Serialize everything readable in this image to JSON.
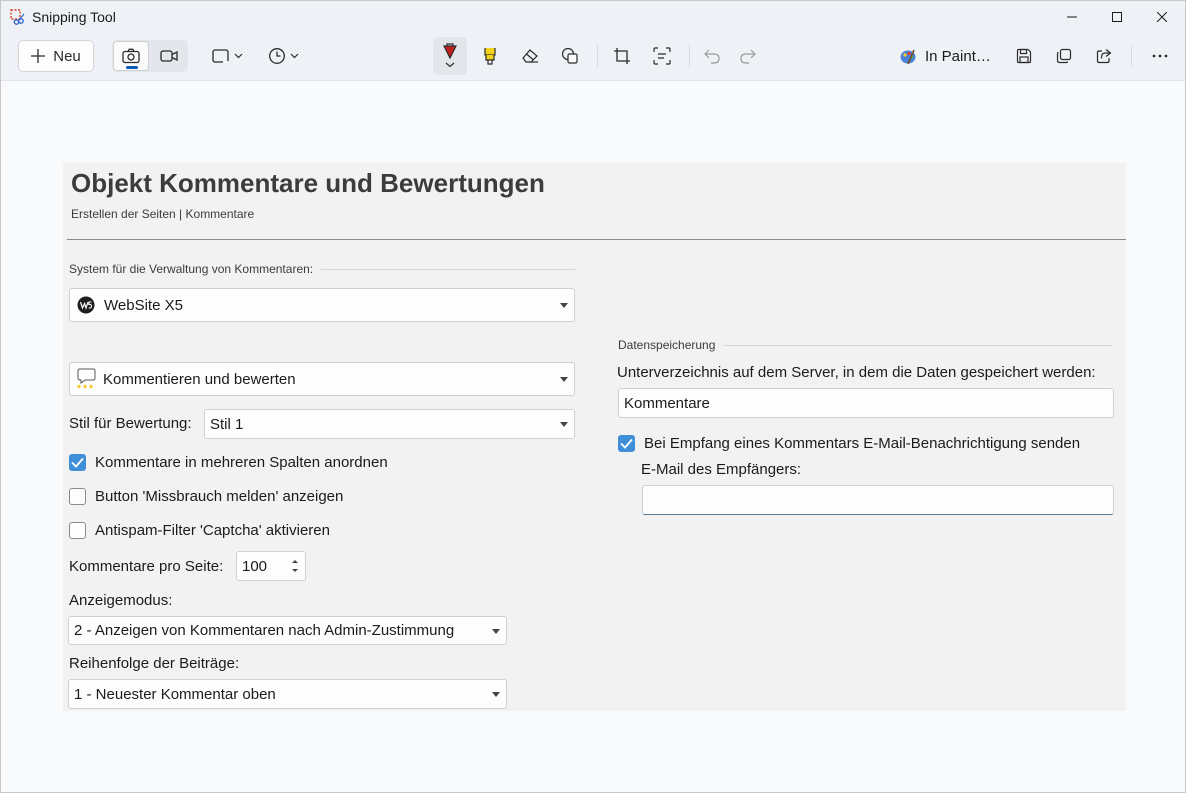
{
  "window": {
    "title": "Snipping Tool"
  },
  "toolbar": {
    "new_label": "Neu",
    "open_in_label": "In Paint…"
  },
  "page": {
    "title": "Objekt Kommentare und Bewertungen",
    "subtitle": "Erstellen der Seiten | Kommentare"
  },
  "left": {
    "system_group_label": "System für die Verwaltung von Kommentaren:",
    "system_value": "WebSite X5",
    "mode_value": "Kommentieren und bewerten",
    "rating_style_label": "Stil für Bewertung:",
    "rating_style_value": "Stil 1",
    "cb_columns_label": "Kommentare in mehreren Spalten anordnen",
    "cb_columns_checked": true,
    "cb_abuse_label": "Button 'Missbrauch melden' anzeigen",
    "cb_abuse_checked": false,
    "cb_captcha_label": "Antispam-Filter 'Captcha' aktivieren",
    "cb_captcha_checked": false,
    "per_page_label": "Kommentare pro Seite:",
    "per_page_value": "100",
    "display_mode_label": "Anzeigemodus:",
    "display_mode_value": "2 - Anzeigen von Kommentaren nach Admin-Zustimmung",
    "order_label": "Reihenfolge der Beiträge:",
    "order_value": "1 - Neuester Kommentar oben"
  },
  "right": {
    "storage_group_label": "Datenspeicherung",
    "subdir_label": "Unterverzeichnis auf dem Server, in dem die Daten gespeichert werden:",
    "subdir_value": "Kommentare",
    "cb_email_label": "Bei Empfang eines Kommentars E-Mail-Benachrichtigung senden",
    "cb_email_checked": true,
    "email_label": "E-Mail des Empfängers:",
    "email_value": ""
  },
  "colors": {
    "accent": "#3f8fd8",
    "highlighter": "#f2d21b",
    "pen": "#c0201e"
  }
}
